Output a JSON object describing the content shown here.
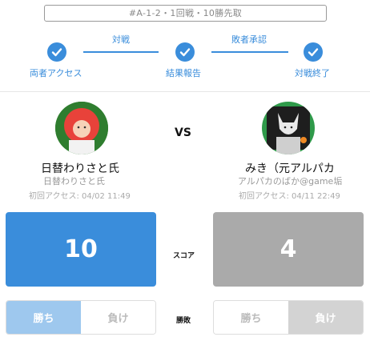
{
  "match": {
    "id_label": "#A-1-2・1回戦・10勝先取"
  },
  "progress": {
    "steps": [
      {
        "label": "両者アクセス",
        "done": true
      },
      {
        "label": "結果報告",
        "done": true
      },
      {
        "label": "対戦終了",
        "done": true
      }
    ],
    "connectors": [
      {
        "label": "対戦"
      },
      {
        "label": "敗者承認"
      }
    ]
  },
  "players": {
    "left": {
      "name": "日替わりさと氏",
      "sub": "日替わりさと氏",
      "access": "初回アクセス: 04/02 11:49",
      "score": "10",
      "result_win": "勝ち",
      "result_lose": "負け",
      "selected": "win"
    },
    "right": {
      "name": "みき（元アルパカ",
      "sub": "アルパカのばか@game垢",
      "access": "初回アクセス: 04/11 22:49",
      "score": "4",
      "result_win": "勝ち",
      "result_lose": "負け",
      "selected": "lose"
    }
  },
  "labels": {
    "vs": "VS",
    "score": "スコア",
    "result": "勝敗"
  },
  "colors": {
    "accent": "#3a8ddb",
    "win_score_bg": "#3a8ddb",
    "lose_score_bg": "#aaaaaa",
    "win_selected_bg": "#9ec8ee",
    "lose_selected_bg": "#d3d3d3"
  }
}
